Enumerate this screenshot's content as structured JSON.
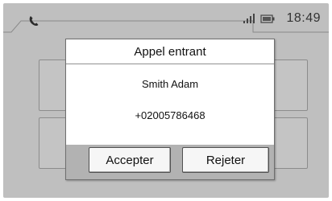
{
  "status_bar": {
    "left_icon": "phone-icon",
    "signal_icon": "signal-strength-icon",
    "battery_icon": "battery-icon",
    "time": "18:49"
  },
  "dialog": {
    "title": "Appel entrant",
    "caller_name": "Smith Adam",
    "caller_number": "+02005786468",
    "accept_label": "Accepter",
    "reject_label": "Rejeter"
  },
  "colors": {
    "screen_background": "#bfbfbf",
    "dialog_background": "#ffffff",
    "button_background": "#f6f6f6"
  }
}
